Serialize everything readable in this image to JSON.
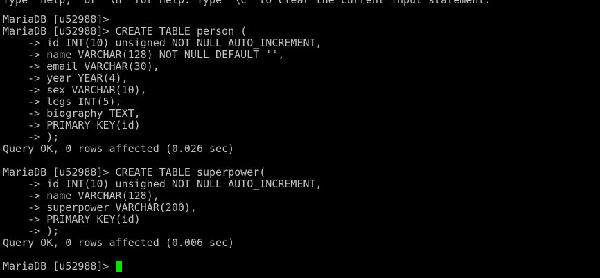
{
  "terminal": {
    "cursor_color": "#00e600",
    "text_color": "#c0c0c0",
    "background_color": "#000000",
    "lines": [
      "Type 'help;' or '\\h' for help. Type '\\c' to clear the current input statement.",
      "MariaDB [u52988]>",
      "MariaDB [u52988]> CREATE TABLE person (",
      "    -> id INT(10) unsigned NOT NULL AUTO_INCREMENT,",
      "    -> name VARCHAR(128) NOT NULL DEFAULT '',",
      "    -> email VARCHAR(30),",
      "    -> year YEAR(4),",
      "    -> sex VARCHAR(10),",
      "    -> legs INT(5),",
      "    -> biography TEXT,",
      "    -> PRIMARY KEY(id)",
      "    -> );",
      "Query OK, 0 rows affected (0.026 sec)",
      "",
      "MariaDB [u52988]> CREATE TABLE superpower(",
      "    -> id INT(10) unsigned NOT NULL AUTO_INCREMENT,",
      "    -> name VARCHAR(128),",
      "    -> superpower VARCHAR(200),",
      "    -> PRIMARY KEY(id)",
      "    -> );",
      "Query OK, 0 rows affected (0.006 sec)",
      "",
      "MariaDB [u52988]> "
    ]
  }
}
